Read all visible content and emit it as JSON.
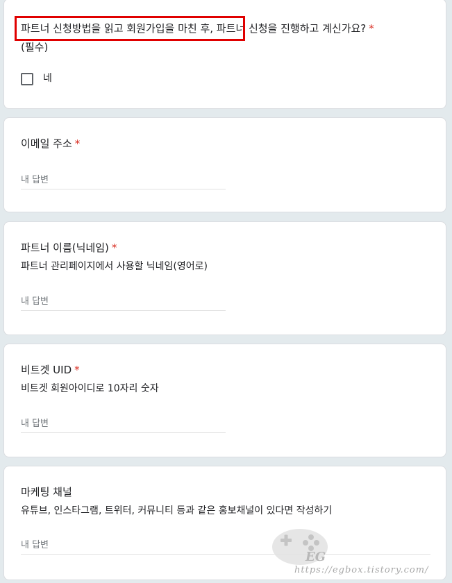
{
  "q1": {
    "title_highlighted": "파트너 신청방법을 읽고 회원가입을 마친 후,",
    "title_rest": " 파트너 신청을 진행하고 계신가요?",
    "required_mark": "*",
    "title_line2": "(필수)",
    "option_label": "네"
  },
  "q2": {
    "title": "이메일 주소",
    "required_mark": "*",
    "placeholder": "내 답변"
  },
  "q3": {
    "title": "파트너 이름(닉네임)",
    "required_mark": "*",
    "description": "파트너 관리페이지에서 사용할 닉네임(영어로)",
    "placeholder": "내 답변"
  },
  "q4": {
    "title": "비트겟 UID",
    "required_mark": "*",
    "description": "비트겟 회원아이디로 10자리 숫자",
    "placeholder": "내 답변"
  },
  "q5": {
    "title": "마케팅 채널",
    "description": "유튜브, 인스타그램, 트위터, 커뮤니티 등과 같은 홍보채널이 있다면 작성하기",
    "placeholder": "내 답변"
  },
  "watermark": {
    "logo": "EG",
    "url": "https://egbox.tistory.com/"
  },
  "colors": {
    "background": "#e3eaed",
    "required": "#d93025",
    "highlight": "#e00000"
  }
}
